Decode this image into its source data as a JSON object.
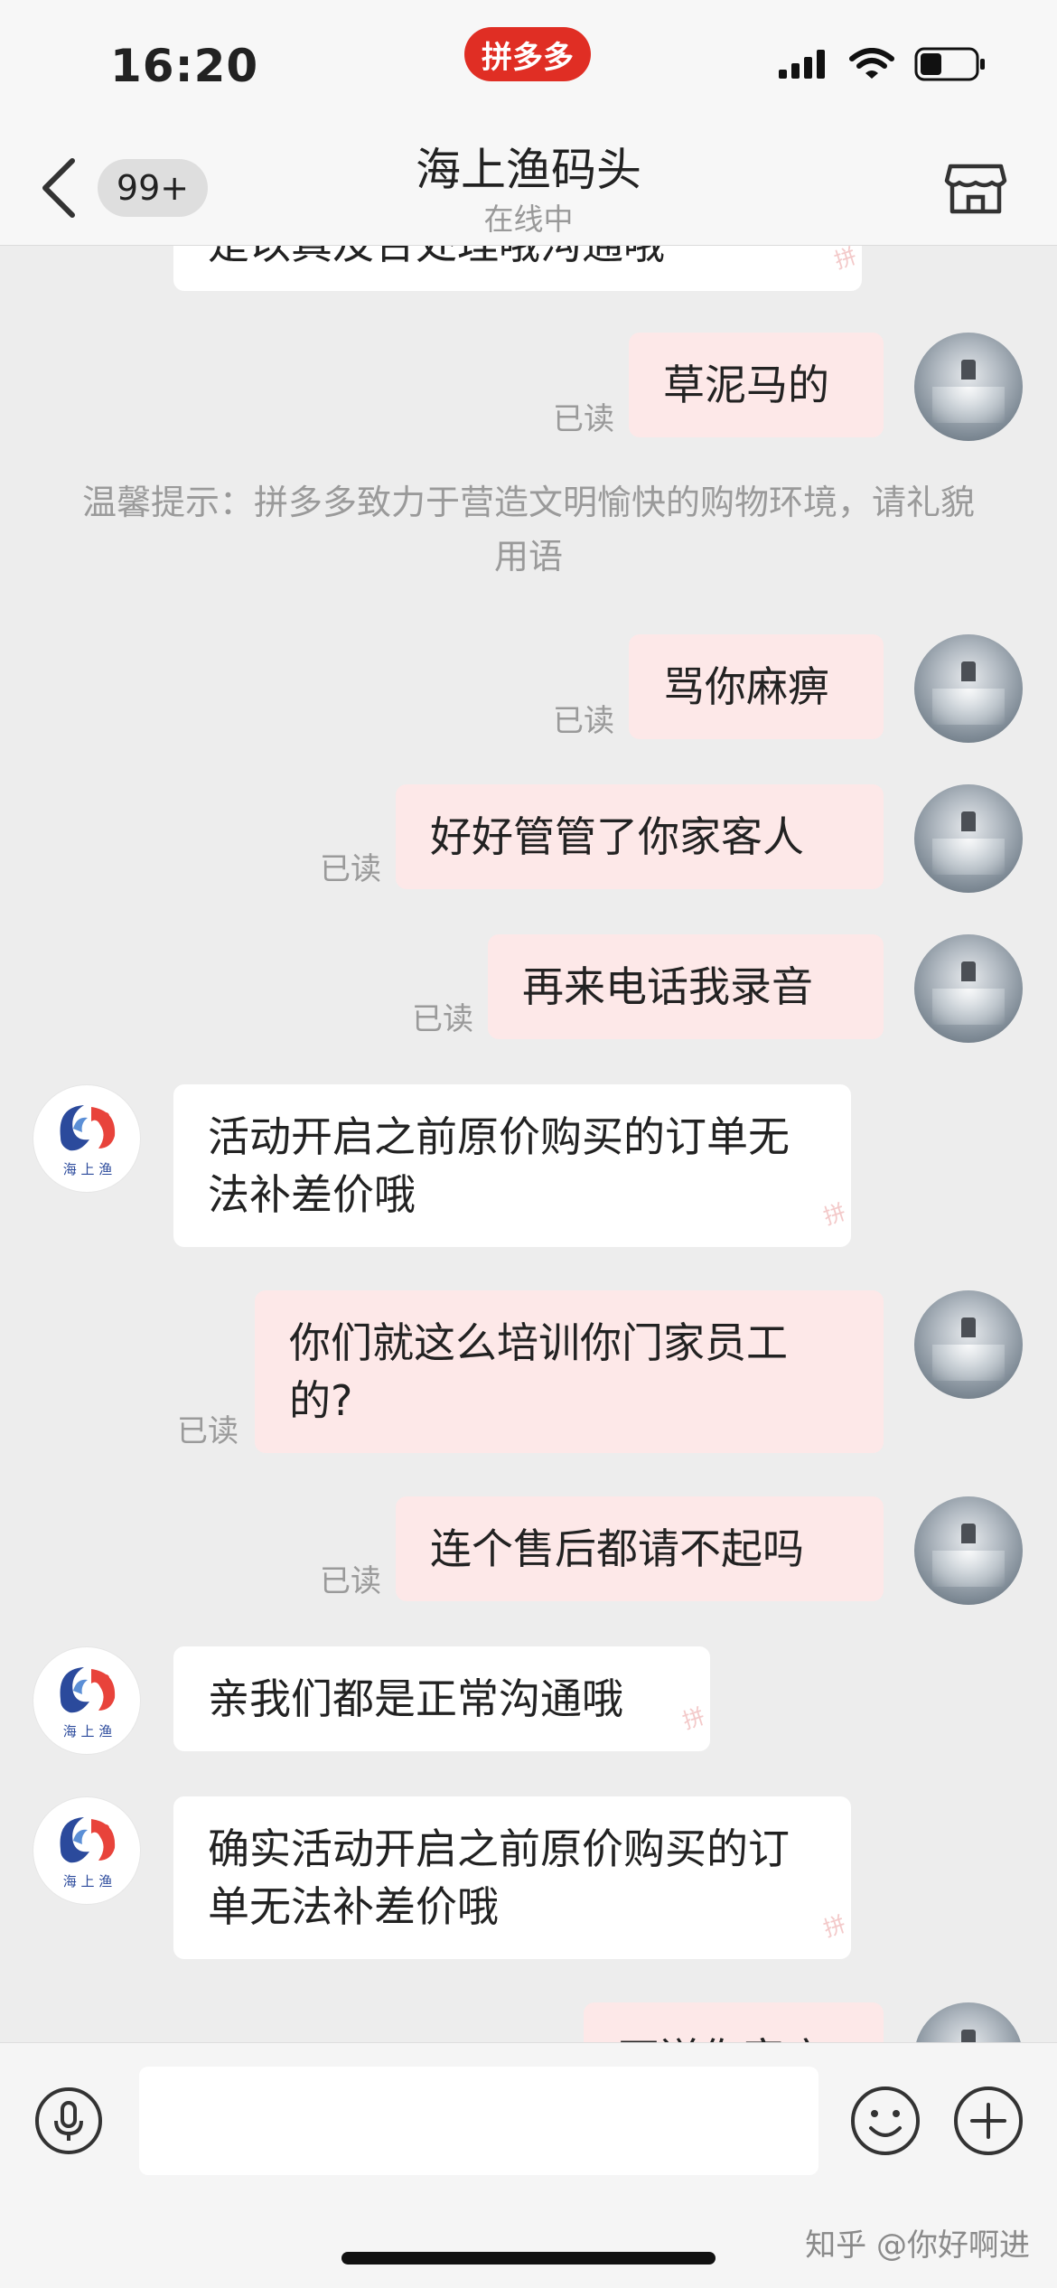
{
  "status_bar": {
    "time": "16:20",
    "app_badge": "拼多多",
    "battery_level": 0.4
  },
  "header": {
    "back_icon": "chevron-left-icon",
    "unread_count": "99+",
    "shop_name": "海上渔码头",
    "shop_status": "在线中",
    "store_icon": "store-icon"
  },
  "messages": [
    {
      "side": "in",
      "text": "是以真及合处理哦沟通哦"
    },
    {
      "side": "out",
      "text": "草泥马的",
      "status": "已读"
    },
    {
      "side": "system",
      "text": "温馨提示：拼多多致力于营造文明愉快的购物环境，请礼貌用语"
    },
    {
      "side": "out",
      "text": "骂你麻痹",
      "status": "已读"
    },
    {
      "side": "out",
      "text": "好好管管了你家客人",
      "status": "已读"
    },
    {
      "side": "out",
      "text": "再来电话我录音",
      "status": "已读"
    },
    {
      "side": "in",
      "text": "活动开启之前原价购买的订单无法补差价哦"
    },
    {
      "side": "out",
      "text": "你们就这么培训你门家员工的?",
      "status": "已读"
    },
    {
      "side": "out",
      "text": "连个售后都请不起吗",
      "status": "已读"
    },
    {
      "side": "in",
      "text": "亲我们都是正常沟通哦"
    },
    {
      "side": "in",
      "text": "确实活动开启之前原价购买的订单无法补差价哦"
    },
    {
      "side": "out",
      "text": "不送你家店"
    }
  ],
  "input_bar": {
    "voice_icon": "microphone-icon",
    "emoji_icon": "smile-icon",
    "more_icon": "plus-icon",
    "text_value": ""
  },
  "watermark": "知乎 @你好啊进",
  "colors": {
    "outgoing_bubble": "#fde8e8",
    "incoming_bubble": "#ffffff",
    "background": "#ededed",
    "brand_red": "#e02e24"
  }
}
